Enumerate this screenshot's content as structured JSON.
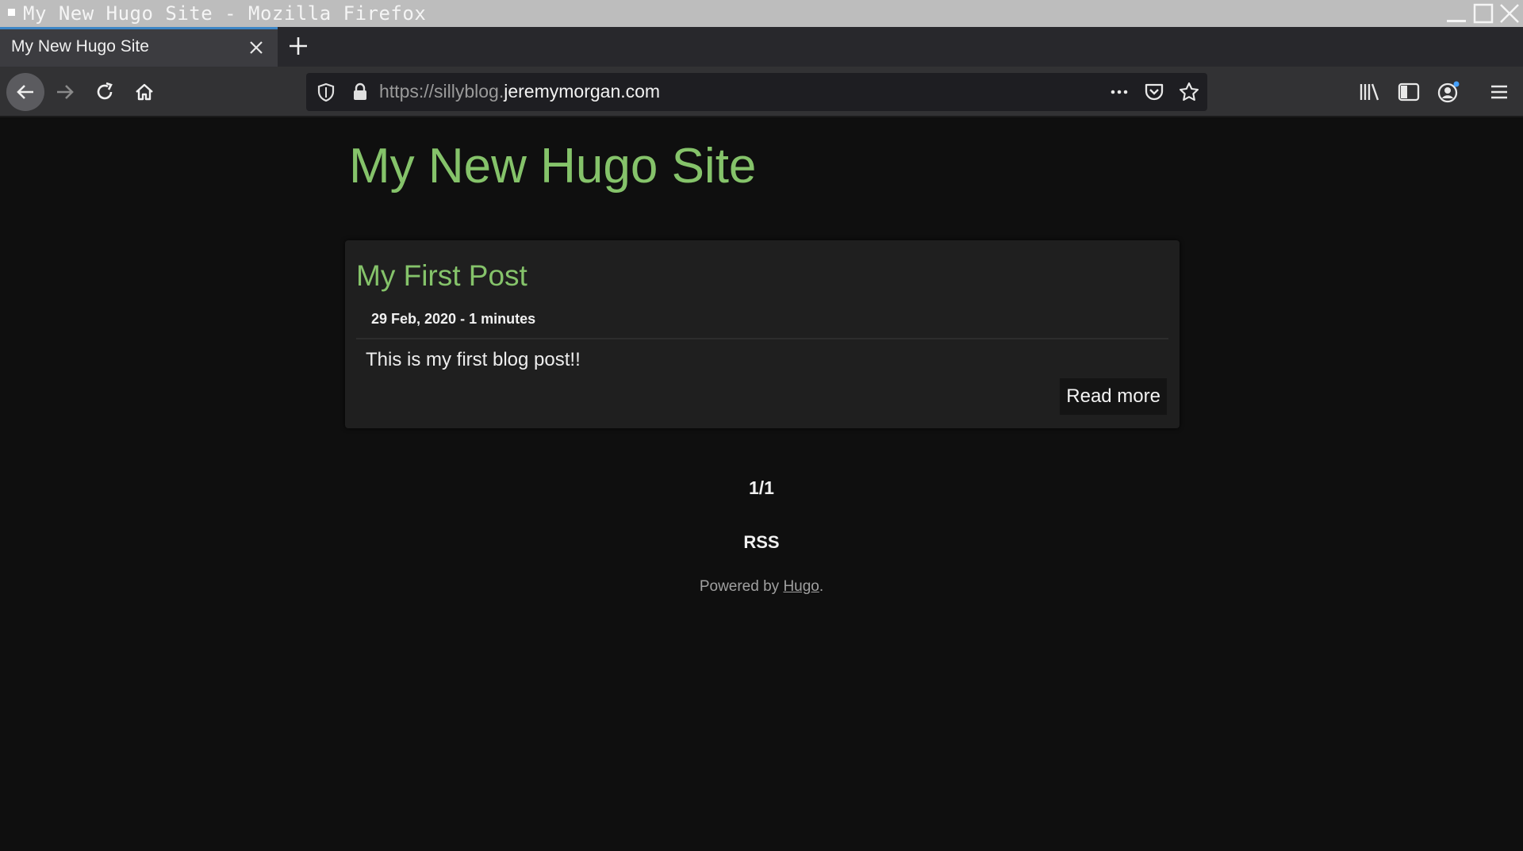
{
  "window": {
    "title": "My New Hugo Site - Mozilla Firefox",
    "controls": [
      "minimize-icon",
      "maximize-icon",
      "close-icon"
    ]
  },
  "tabs": [
    {
      "label": "My New Hugo Site",
      "active": true
    }
  ],
  "navbar": {
    "url_prefix": "https://sillyblog.",
    "url_domain": "jeremymorgan.com",
    "icons": [
      "back-arrow-icon",
      "forward-arrow-icon",
      "reload-icon",
      "home-icon",
      "shield-icon",
      "lock-icon",
      "more-dots-icon",
      "pocket-icon",
      "star-icon",
      "library-icon",
      "sidebar-icon",
      "account-icon",
      "hamburger-menu-icon"
    ]
  },
  "page": {
    "site_title": "My New Hugo Site",
    "posts": [
      {
        "title": "My First Post",
        "meta": "29 Feb, 2020 - 1 minutes",
        "summary": "This is my first blog post!!",
        "read_more": "Read more"
      }
    ],
    "pagination": "1/1",
    "rss": "RSS",
    "footer_prefix": "Powered by ",
    "footer_link": "Hugo",
    "footer_suffix": "."
  },
  "colors": {
    "accent_green": "#85c36a",
    "page_background": "#0f0f0f",
    "card_background": "#1f1f1f"
  }
}
